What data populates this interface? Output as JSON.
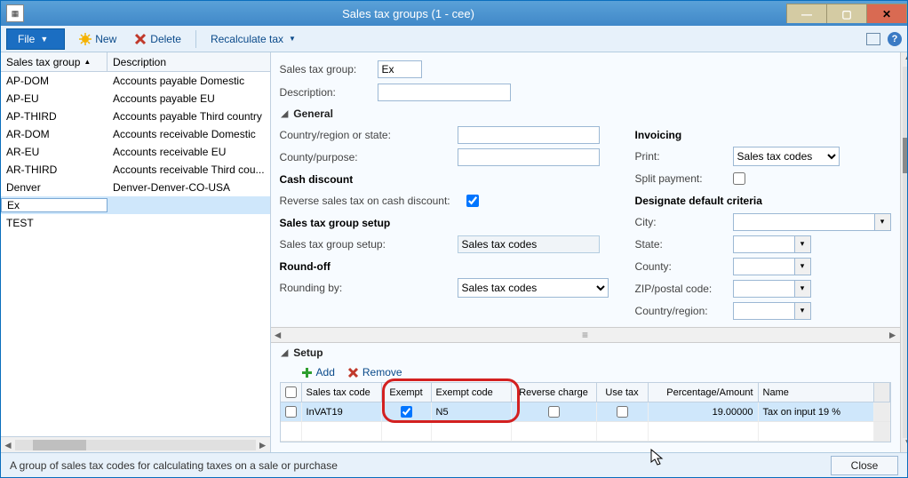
{
  "window": {
    "title": "Sales tax groups (1 - cee)"
  },
  "menu": {
    "file": "File",
    "new": "New",
    "delete": "Delete",
    "recalc": "Recalculate tax"
  },
  "grid": {
    "col1": "Sales tax group",
    "col2": "Description",
    "rows": [
      {
        "code": "AP-DOM",
        "desc": "Accounts payable Domestic"
      },
      {
        "code": "AP-EU",
        "desc": "Accounts payable EU"
      },
      {
        "code": "AP-THIRD",
        "desc": "Accounts payable Third country"
      },
      {
        "code": "AR-DOM",
        "desc": "Accounts receivable Domestic"
      },
      {
        "code": "AR-EU",
        "desc": "Accounts receivable EU"
      },
      {
        "code": "AR-THIRD",
        "desc": "Accounts receivable Third cou..."
      },
      {
        "code": "Denver",
        "desc": "Denver-Denver-CO-USA"
      },
      {
        "code": "Ex",
        "desc": ""
      },
      {
        "code": "TEST",
        "desc": ""
      }
    ],
    "selected_index": 7
  },
  "detail": {
    "sales_tax_group_lbl": "Sales tax group:",
    "sales_tax_group_val": "Ex",
    "description_lbl": "Description:",
    "description_val": "",
    "general_head": "General",
    "country_region_lbl": "Country/region or state:",
    "county_purpose_lbl": "County/purpose:",
    "cash_discount_head": "Cash discount",
    "reverse_cash_lbl": "Reverse sales tax on cash discount:",
    "reverse_cash_checked": true,
    "setup_head": "Sales tax group setup",
    "setup_lbl": "Sales tax group setup:",
    "setup_val": "Sales tax codes",
    "roundoff_head": "Round-off",
    "rounding_by_lbl": "Rounding by:",
    "rounding_by_val": "Sales tax codes",
    "invoicing_head": "Invoicing",
    "print_lbl": "Print:",
    "print_val": "Sales tax codes",
    "split_payment_lbl": "Split payment:",
    "designate_head": "Designate default criteria",
    "city_lbl": "City:",
    "state_lbl": "State:",
    "county_lbl": "County:",
    "zip_lbl": "ZIP/postal code:",
    "country_lbl": "Country/region:"
  },
  "setup": {
    "head": "Setup",
    "add": "Add",
    "remove": "Remove",
    "cols": {
      "c1": "Sales tax code",
      "c2": "Exempt",
      "c3": "Exempt code",
      "c4": "Reverse charge",
      "c5": "Use tax",
      "c6": "Percentage/Amount",
      "c7": "Name"
    },
    "row": {
      "code": "InVAT19",
      "exempt": true,
      "exempt_code": "N5",
      "reverse": false,
      "use_tax": false,
      "pct": "19.00000",
      "name": "Tax on input 19 %"
    }
  },
  "status": {
    "msg": "A group of sales tax codes for calculating taxes on a sale or purchase",
    "close": "Close"
  }
}
